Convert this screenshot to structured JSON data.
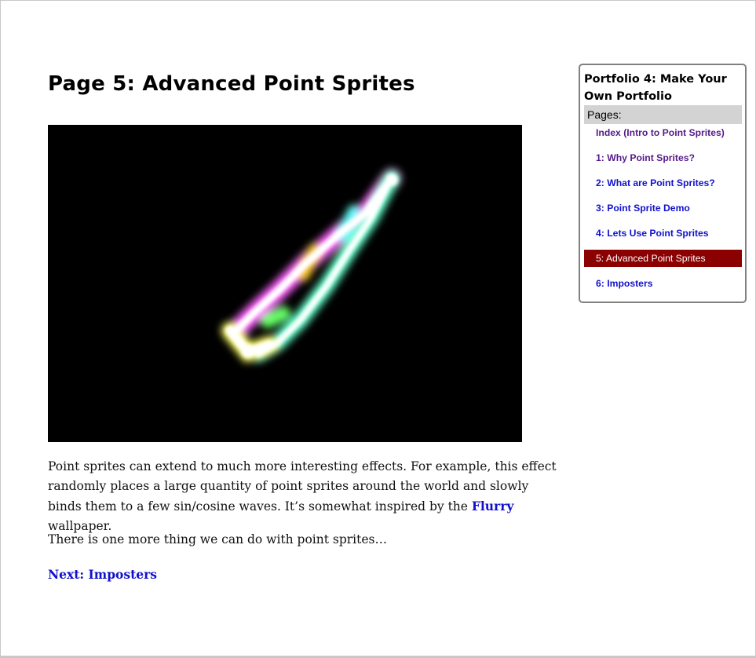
{
  "page": {
    "title": "Page 5: Advanced Point Sprites"
  },
  "content": {
    "paragraph1": {
      "text_before_link": "Point sprites can extend to much more interesting effects. For example, this effect randomly places a large quantity of point sprites around the world and slowly binds them to a few sin/cosine waves. It’s somewhat inspired by the ",
      "link_text": "Flurry",
      "text_after_link": " wallpaper."
    },
    "paragraph2": "There is one more thing we can do with point sprites…",
    "next_link": "Next: Imposters"
  },
  "sidebar": {
    "title": "Portfolio 4: Make Your Own Portfolio",
    "pages_label": "Pages:",
    "items": [
      {
        "label": "Index (Intro to Point Sprites)",
        "state": "visited"
      },
      {
        "label": "1: Why Point Sprites?",
        "state": "visited"
      },
      {
        "label": "2: What are Point Sprites?",
        "state": "link"
      },
      {
        "label": "3: Point Sprite Demo",
        "state": "link"
      },
      {
        "label": "4: Lets Use Point Sprites",
        "state": "link"
      },
      {
        "label": "5: Advanced Point Sprites",
        "state": "active"
      },
      {
        "label": "6: Imposters",
        "state": "link"
      }
    ]
  },
  "colors": {
    "link": "#1111cc",
    "visited": "#551a8b",
    "active_bg": "#8b0000",
    "pages_bg": "#d3d3d3"
  }
}
